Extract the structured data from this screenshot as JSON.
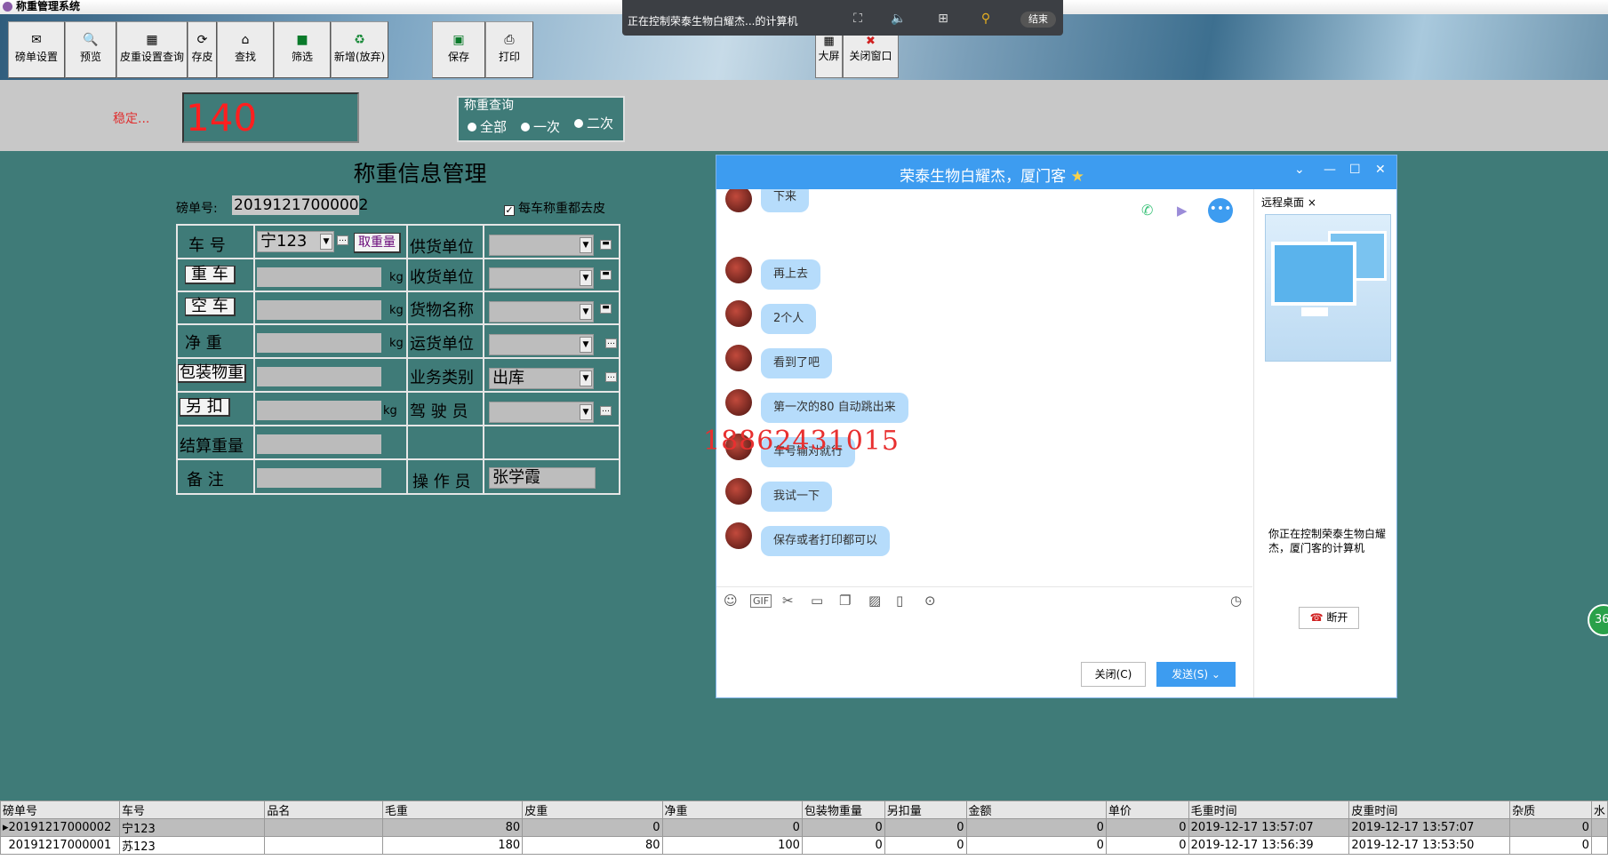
{
  "app": {
    "title": "称重管理系统"
  },
  "toolbar": {
    "buttons": [
      {
        "label": "磅单设置",
        "icon": "✉"
      },
      {
        "label": "预览",
        "icon": "🔍"
      },
      {
        "label": "皮重设置查询",
        "icon": "▦"
      },
      {
        "label": "存皮",
        "icon": "⟳"
      },
      {
        "label": "查找",
        "icon": "⌂"
      },
      {
        "label": "筛选",
        "icon": "■"
      },
      {
        "label": "新增(放弃)",
        "icon": "♻"
      },
      {
        "label": "保存",
        "icon": "▣"
      },
      {
        "label": "打印",
        "icon": "⎙"
      }
    ],
    "screen_label": "大屏",
    "close_label": "关闭窗口"
  },
  "remote": {
    "status": "正在控制荣泰生物白耀杰...的计算机",
    "end_label": "结束"
  },
  "scale": {
    "stable_label": "稳定...",
    "weight_value": "140",
    "query_legend": "称重查询",
    "query_options": [
      "全部",
      "一次",
      "二次"
    ]
  },
  "form": {
    "title": "称重信息管理",
    "bill_no_label": "磅单号:",
    "bill_no_value": "20191217000002",
    "tare_check_label": "每车称重都去皮",
    "plate_label": "车  号",
    "plate_value": "宁123",
    "take_weight_btn": "取重量",
    "gross_btn": "重 车",
    "empty_btn": "空 车",
    "net_label": "净  重",
    "pkg_btn": "包装物重",
    "extra_btn": "另 扣",
    "settle_label": "结算重量",
    "remark_label": "备   注",
    "kg": "kg",
    "supplier_label": "供货单位",
    "receiver_label": "收货单位",
    "goods_label": "货物名称",
    "carrier_label": "运货单位",
    "biz_label": "业务类别",
    "biz_value": "出库",
    "driver_label": "驾 驶 员",
    "operator_label": "操 作 员",
    "operator_value": "张学霞"
  },
  "chat": {
    "title": "荣泰生物白耀杰，厦门客",
    "messages": [
      "下来",
      "再上去",
      "2个人",
      "看到了吧",
      "第一次的80  自动跳出来",
      "车号输对就行",
      "我试一下",
      "保存或者打印都可以"
    ],
    "phone_overlay": "18862431015",
    "close_label": "关闭(C)",
    "send_label": "发送(S)",
    "side_tab": "远程桌面",
    "side_status": "你正在控制荣泰生物白耀杰，厦门客的计算机",
    "disconnect_label": "断开"
  },
  "floating_badge": "36",
  "table": {
    "headers": [
      "磅单号",
      "车号",
      "品名",
      "毛重",
      "皮重",
      "净重",
      "包装物重量",
      "另扣量",
      "金额",
      "单价",
      "毛重时间",
      "皮重时间",
      "杂质",
      "水"
    ],
    "rows": [
      [
        "20191217000002",
        "宁123",
        "",
        "80",
        "0",
        "0",
        "0",
        "0",
        "0",
        "0",
        "2019-12-17 13:57:07",
        "2019-12-17 13:57:07",
        "0",
        ""
      ],
      [
        "20191217000001",
        "苏123",
        "",
        "180",
        "80",
        "100",
        "0",
        "0",
        "0",
        "0",
        "2019-12-17 13:56:39",
        "2019-12-17 13:53:50",
        "0",
        ""
      ]
    ]
  }
}
